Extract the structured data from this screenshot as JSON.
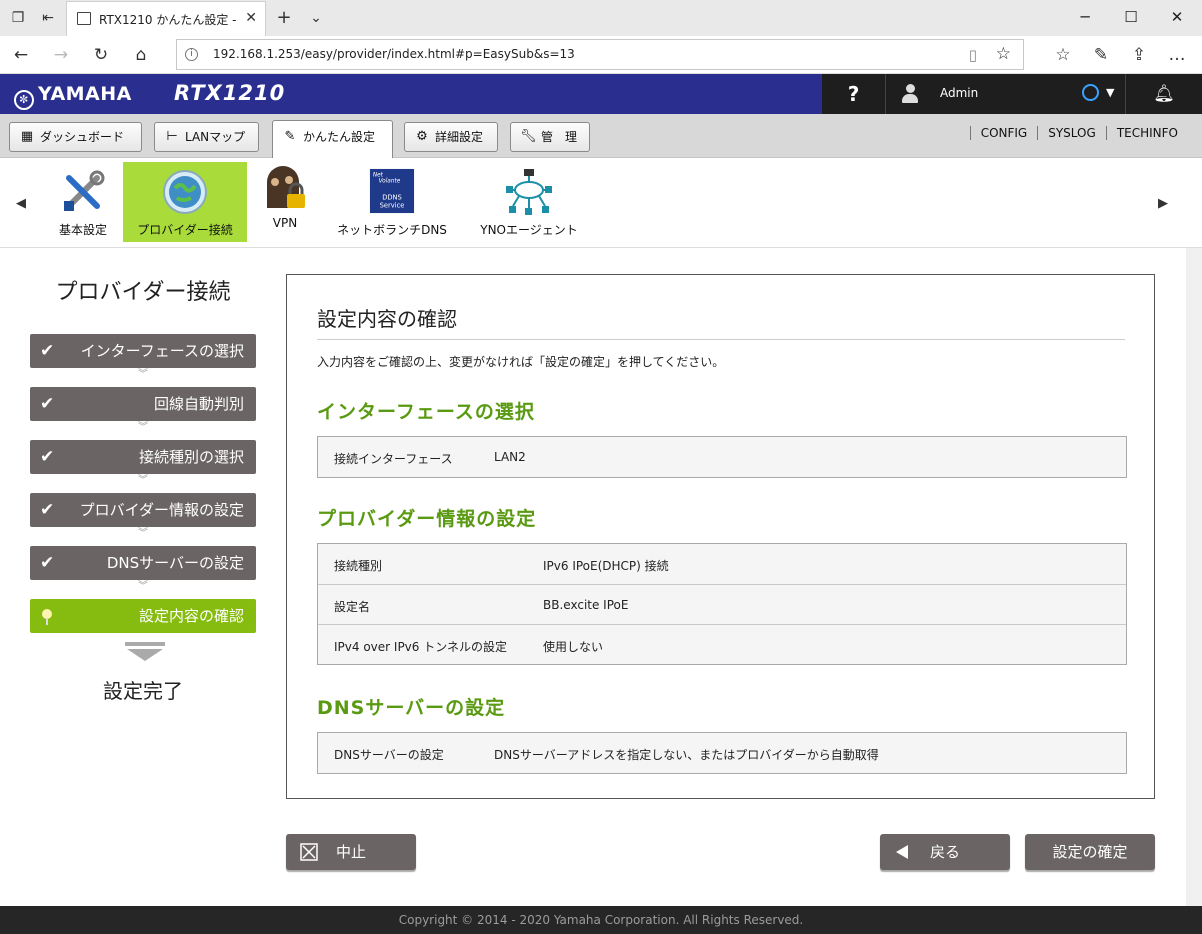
{
  "browser": {
    "tab_title": "RTX1210 かんたん設定 -",
    "url": "192.168.1.253/easy/provider/index.html#p=EasySub&s=13"
  },
  "header": {
    "brand": "YAMAHA",
    "model": "RTX1210",
    "help_label": "?",
    "user_name": "Admin"
  },
  "topnav": {
    "buttons": [
      {
        "label": "ダッシュボード",
        "icon": "dashboard-icon"
      },
      {
        "label": "LANマップ",
        "icon": "lanmap-icon"
      },
      {
        "label": "かんたん設定",
        "icon": "wand-icon"
      },
      {
        "label": "詳細設定",
        "icon": "gear-icon"
      },
      {
        "label": "管　理",
        "icon": "wrench-icon"
      }
    ],
    "links": [
      "CONFIG",
      "SYSLOG",
      "TECHINFO"
    ]
  },
  "functions": [
    {
      "label": "基本設定",
      "icon": "tools-icon"
    },
    {
      "label": "プロバイダー接続",
      "icon": "globe-icon"
    },
    {
      "label": "VPN",
      "icon": "vpn-lock-icon"
    },
    {
      "label": "ネットボランチDNS",
      "icon": "ddns-icon",
      "icon_text": [
        "Net",
        "Volante",
        "DDNS",
        "Service"
      ]
    },
    {
      "label": "YNOエージェント",
      "icon": "network-cloud-icon"
    }
  ],
  "wizard": {
    "title": "プロバイダー接続",
    "steps": [
      {
        "label": "インターフェースの選択",
        "state": "done"
      },
      {
        "label": "回線自動判別",
        "state": "done"
      },
      {
        "label": "接続種別の選択",
        "state": "done"
      },
      {
        "label": "プロバイダー情報の設定",
        "state": "done"
      },
      {
        "label": "DNSサーバーの設定",
        "state": "done"
      },
      {
        "label": "設定内容の確認",
        "state": "current"
      }
    ],
    "final": "設定完了"
  },
  "panel": {
    "title": "設定内容の確認",
    "description": "入力内容をご確認の上、変更がなければ「設定の確定」を押してください。",
    "sections": [
      {
        "heading": "インターフェースの選択",
        "rows": [
          {
            "key": "接続インターフェース",
            "value": "LAN2"
          }
        ]
      },
      {
        "heading": "プロバイダー情報の設定",
        "rows": [
          {
            "key": "接続種別",
            "value": "IPv6 IPoE(DHCP) 接続"
          },
          {
            "key": "設定名",
            "value": "BB.excite IPoE"
          },
          {
            "key": "IPv4 over IPv6 トンネルの設定",
            "value": "使用しない"
          }
        ]
      },
      {
        "heading": "DNSサーバーの設定",
        "rows": [
          {
            "key": "DNSサーバーの設定",
            "value": "DNSサーバーアドレスを指定しない、またはプロバイダーから自動取得"
          }
        ]
      }
    ]
  },
  "actions": {
    "cancel": "中止",
    "back": "戻る",
    "confirm": "設定の確定"
  },
  "footer": {
    "copyright": "Copyright © 2014 - 2020 Yamaha Corporation. All Rights Reserved."
  },
  "colors": {
    "header_blue": "#2a2f8f",
    "accent_green": "#86bc0f",
    "section_green": "#5a9a12",
    "step_gray": "#6a6464"
  }
}
